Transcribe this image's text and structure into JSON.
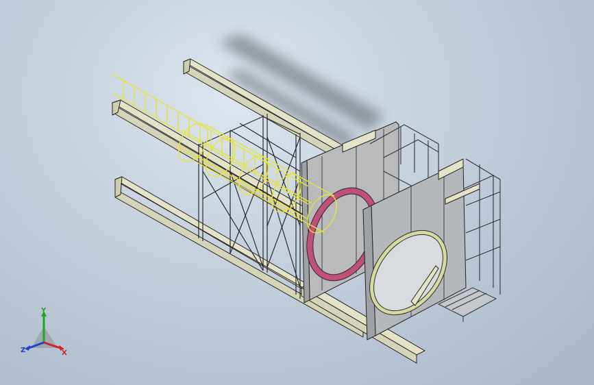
{
  "viewport": {
    "background_top": "#dde6ee",
    "background_bottom": "#a9b7c8"
  },
  "triad": {
    "x_label": "X",
    "y_label": "Y",
    "z_label": "Z",
    "x_color": "#d42020",
    "y_color": "#1fa81f",
    "z_color": "#2040d0"
  },
  "model": {
    "beam_color": "#e4e2c8",
    "plate_color": "#b5b8ba",
    "ladder_color": "#e8e23a",
    "ring_color": "#c0507a",
    "ring2_color": "#d6d9a0"
  }
}
